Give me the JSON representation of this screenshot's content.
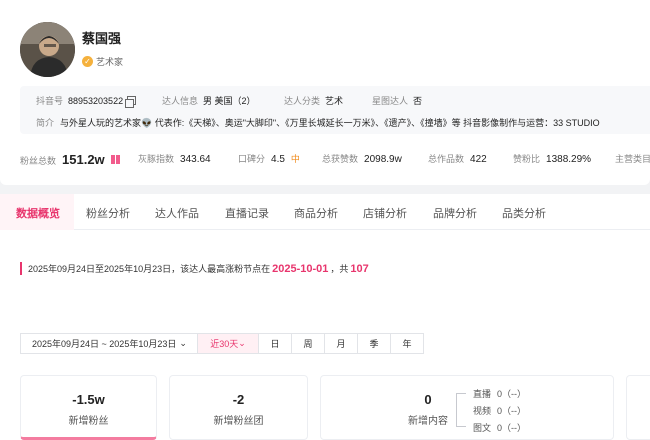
{
  "profile": {
    "name": "蔡国强",
    "role": "艺术家",
    "douyin_label": "抖音号",
    "douyin_id": "88953203522",
    "info_label": "达人信息",
    "info_value": "男 美国（2）",
    "category_label": "达人分类",
    "category_value": "艺术",
    "star_label": "星图达人",
    "star_value": "否",
    "intro_label": "简介",
    "intro_text": "与外星人玩的艺术家👽 代表作:《天梯》、奥运\"大脚印\"、《万里长城延长一万米》、《遗产》、《撞墙》等 抖音影像制作与运营：33 STUDIO"
  },
  "stats": [
    {
      "label": "粉丝总数",
      "value": "151.2w"
    },
    {
      "label": "灰豚指数",
      "value": "343.64"
    },
    {
      "label": "口碑分",
      "value": "4.5",
      "tag": "中"
    },
    {
      "label": "总获赞数",
      "value": "2098.9w"
    },
    {
      "label": "总作品数",
      "value": "422"
    },
    {
      "label": "赞粉比",
      "value": "1388.29%"
    },
    {
      "label": "主营类目",
      "value": ""
    }
  ],
  "tabs": [
    "数据概览",
    "粉丝分析",
    "达人作品",
    "直播记录",
    "商品分析",
    "店铺分析",
    "品牌分析",
    "品类分析"
  ],
  "note": {
    "prefix": "2025年09月24日至2025年10月23日，该达人最高涨粉节点在",
    "date": "2025-10-01",
    "mid": "，共",
    "count": "107"
  },
  "filter": {
    "date_range": "2025年09月24日 ~ 2025年10月23日",
    "options": [
      "近30天",
      "日",
      "周",
      "月",
      "季",
      "年"
    ]
  },
  "metrics": [
    {
      "value": "-1.5w",
      "label": "新增粉丝"
    },
    {
      "value": "-2",
      "label": "新增粉丝团"
    },
    {
      "value": "0",
      "label": "新增内容"
    }
  ],
  "content_breakdown": [
    {
      "label": "直播",
      "value": "0（--）"
    },
    {
      "label": "视频",
      "value": "0（--）"
    },
    {
      "label": "图文",
      "value": "0（--）"
    }
  ],
  "colors": {
    "accent": "#e8356d",
    "orange": "#f08b1d"
  }
}
